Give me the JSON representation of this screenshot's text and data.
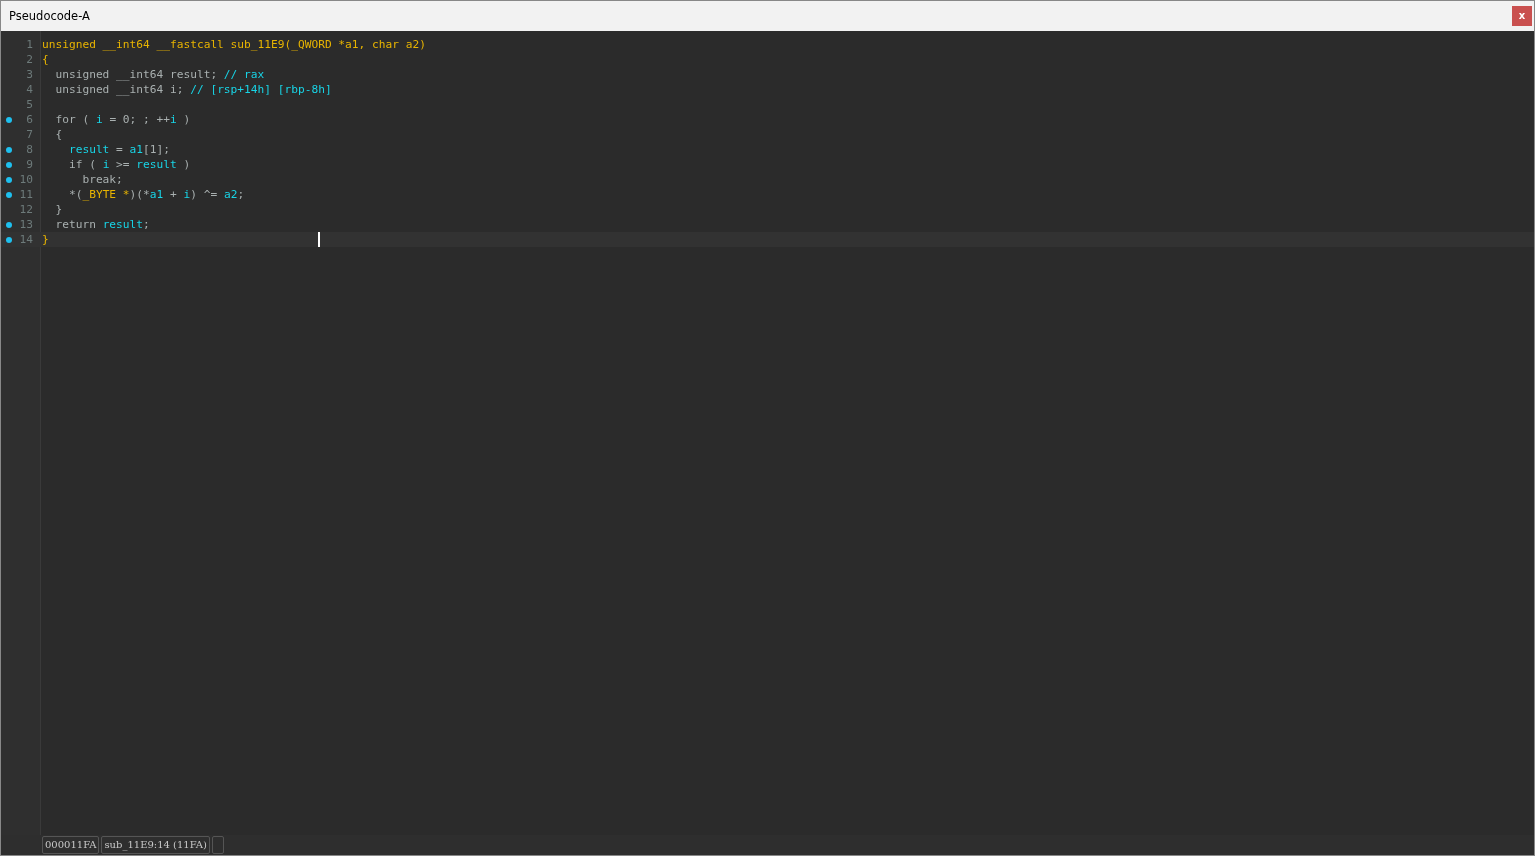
{
  "window": {
    "title": "Pseudocode-A",
    "close": "x"
  },
  "code": {
    "lines": [
      {
        "number": "1",
        "marked": false,
        "selected": false,
        "tokens": [
          {
            "kind": "type",
            "text": "unsigned __int64 __fastcall sub_11E9(_QWORD *a1, char a2)"
          }
        ]
      },
      {
        "number": "2",
        "marked": false,
        "selected": false,
        "tokens": [
          {
            "kind": "type",
            "text": "{"
          }
        ]
      },
      {
        "number": "3",
        "marked": false,
        "selected": false,
        "tokens": [
          {
            "kind": "kw",
            "text": "  unsigned __int64 result; "
          },
          {
            "kind": "var",
            "text": "// rax"
          }
        ]
      },
      {
        "number": "4",
        "marked": false,
        "selected": false,
        "tokens": [
          {
            "kind": "kw",
            "text": "  unsigned __int64 i; "
          },
          {
            "kind": "var",
            "text": "// [rsp+14h] [rbp-8h]"
          }
        ]
      },
      {
        "number": "5",
        "marked": false,
        "selected": false
      },
      {
        "number": "6",
        "marked": true,
        "selected": false,
        "tokens": [
          {
            "kind": "kw",
            "text": "  for ( "
          },
          {
            "kind": "var",
            "text": "i"
          },
          {
            "kind": "kw",
            "text": " = 0; ; ++"
          },
          {
            "kind": "var",
            "text": "i"
          },
          {
            "kind": "kw",
            "text": " )"
          }
        ]
      },
      {
        "number": "7",
        "marked": false,
        "selected": false,
        "tokens": [
          {
            "kind": "kw",
            "text": "  {"
          }
        ]
      },
      {
        "number": "8",
        "marked": true,
        "selected": false,
        "tokens": [
          {
            "kind": "var",
            "text": "    result"
          },
          {
            "kind": "kw",
            "text": " = "
          },
          {
            "kind": "var",
            "text": "a1"
          },
          {
            "kind": "kw",
            "text": "[1];"
          }
        ]
      },
      {
        "number": "9",
        "marked": true,
        "selected": false,
        "tokens": [
          {
            "kind": "kw",
            "text": "    if ( "
          },
          {
            "kind": "var",
            "text": "i"
          },
          {
            "kind": "kw",
            "text": " >= "
          },
          {
            "kind": "var",
            "text": "result"
          },
          {
            "kind": "kw",
            "text": " )"
          }
        ]
      },
      {
        "number": "10",
        "marked": true,
        "selected": false,
        "tokens": [
          {
            "kind": "kw",
            "text": "      break;"
          }
        ]
      },
      {
        "number": "11",
        "marked": true,
        "selected": false,
        "tokens": [
          {
            "kind": "kw",
            "text": "    *("
          },
          {
            "kind": "type",
            "text": "_BYTE *"
          },
          {
            "kind": "kw",
            "text": ")(*"
          },
          {
            "kind": "var",
            "text": "a1"
          },
          {
            "kind": "kw",
            "text": " + "
          },
          {
            "kind": "var",
            "text": "i"
          },
          {
            "kind": "kw",
            "text": ") ^= "
          },
          {
            "kind": "var",
            "text": "a2"
          },
          {
            "kind": "kw",
            "text": ";"
          }
        ]
      },
      {
        "number": "12",
        "marked": false,
        "selected": false,
        "tokens": [
          {
            "kind": "kw",
            "text": "  }"
          }
        ]
      },
      {
        "number": "13",
        "marked": true,
        "selected": false,
        "tokens": [
          {
            "kind": "kw",
            "text": "  return "
          },
          {
            "kind": "var",
            "text": "result"
          },
          {
            "kind": "kw",
            "text": ";"
          }
        ]
      },
      {
        "number": "14",
        "marked": true,
        "selected": true,
        "tokens": [
          {
            "kind": "type",
            "text": "}"
          }
        ]
      }
    ]
  },
  "status_bar": {
    "address": "000011FA",
    "location": "sub_11E9:14 (11FA)"
  }
}
